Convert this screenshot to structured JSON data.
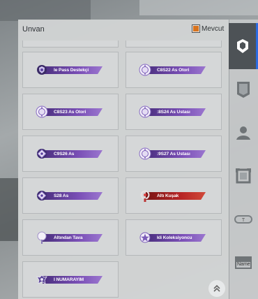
{
  "header": {
    "title": "Unvan",
    "owned_label": "Mevcut",
    "owned_checked": true,
    "accent": "#d8731d"
  },
  "titles": [
    {
      "label": "le Pass Destekçi",
      "style": "purple",
      "emblem": "shield"
    },
    {
      "label": "C8S22 As Otori",
      "style": "purple",
      "emblem": "crest"
    },
    {
      "label": "C8S23 As Otori",
      "style": "purple",
      "emblem": "crest"
    },
    {
      "label": ":8S24 As Ustası",
      "style": "purple",
      "emblem": "crest"
    },
    {
      "label": "C9S26 As",
      "style": "purple",
      "emblem": "diamond"
    },
    {
      "label": ":9S27 As Ustası",
      "style": "purple",
      "emblem": "crest"
    },
    {
      "label": "S28 As",
      "style": "purple",
      "emblem": "diamond"
    },
    {
      "label": "Altı Kuşak",
      "style": "red",
      "emblem": "ring"
    },
    {
      "label": "Altından Tava",
      "style": "purple",
      "emblem": "pan"
    },
    {
      "label": "kli Koleksiyoncu",
      "style": "purple",
      "emblem": "star"
    },
    {
      "label": "I NUMARAYIM",
      "style": "purple",
      "emblem": "wings"
    }
  ],
  "sidebar": {
    "tabs": [
      {
        "name": "tab-title",
        "icon": "title-emblem-icon",
        "active": true
      },
      {
        "name": "tab-banner",
        "icon": "banner-icon",
        "active": false
      },
      {
        "name": "tab-avatar",
        "icon": "avatar-icon",
        "active": false
      },
      {
        "name": "tab-frame",
        "icon": "frame-icon",
        "active": false
      },
      {
        "name": "tab-tag",
        "icon": "tag-icon",
        "active": false
      },
      {
        "name": "tab-nameplate",
        "icon": "nameplate-icon",
        "active": false
      }
    ],
    "nameplate_text": "Name"
  },
  "scroll_top_icon": "double-chevron-up-icon"
}
